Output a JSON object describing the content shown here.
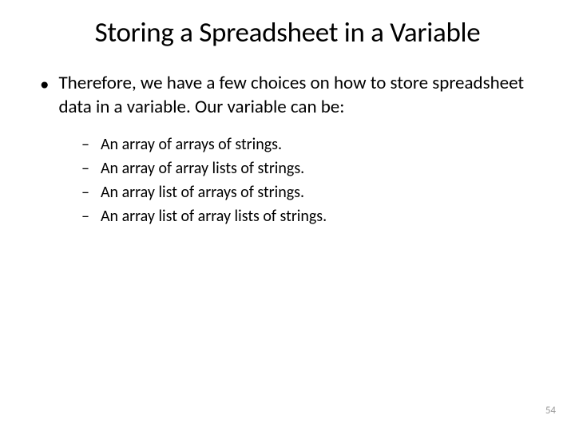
{
  "title": "Storing a Spreadsheet in a Variable",
  "body": {
    "intro": "Therefore, we have a few choices on how to store spreadsheet data in a variable. Our variable can be:",
    "options": [
      "An array of arrays of strings.",
      "An array of array lists of strings.",
      "An array list of arrays of strings.",
      "An array list of array lists of strings."
    ]
  },
  "bullets": {
    "level1": "•",
    "level2": "–"
  },
  "page_number": "54"
}
